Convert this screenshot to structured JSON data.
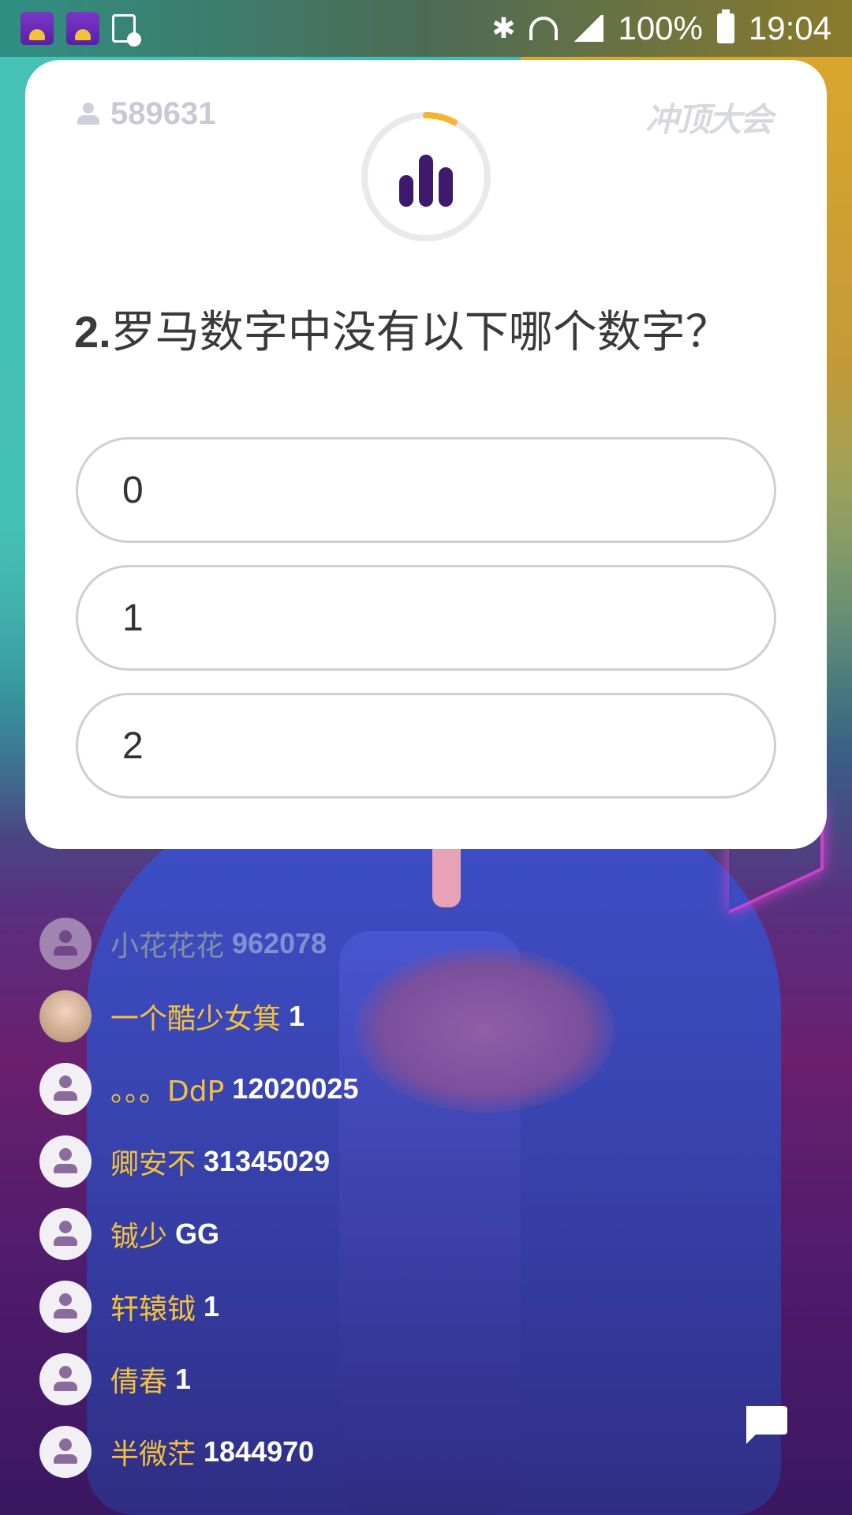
{
  "status_bar": {
    "battery": "100%",
    "time": "19:04",
    "left_icons": [
      "app-icon",
      "app-icon",
      "battery-saver-icon"
    ],
    "right_icons": [
      "bluetooth-icon",
      "wifi-icon",
      "signal-icon",
      "battery-icon"
    ]
  },
  "quiz": {
    "viewer_count": "589631",
    "logo": "冲顶大会",
    "question_number": "2.",
    "question_text": "罗马数字中没有以下哪个数字？",
    "options": [
      "0",
      "1",
      "2"
    ]
  },
  "comments": [
    {
      "user": "小花花花",
      "message": "962078",
      "faded": true
    },
    {
      "user": "一个酷少女箕",
      "message": "1",
      "faded": false,
      "avatar": "photo"
    },
    {
      "user": "。。。DdP",
      "message": "12020025",
      "faded": false
    },
    {
      "user": "卿安不",
      "message": "31345029",
      "faded": false
    },
    {
      "user": "铖少",
      "message": "GG",
      "faded": false
    },
    {
      "user": "轩辕钺",
      "message": "1",
      "faded": false
    },
    {
      "user": "倩春",
      "message": "1",
      "faded": false
    },
    {
      "user": "半微茫",
      "message": "1844970",
      "faded": false
    }
  ],
  "colors": {
    "username": "#f2c23b",
    "timer_accent": "#f6b531",
    "icon_purple": "#3d1a6e"
  }
}
